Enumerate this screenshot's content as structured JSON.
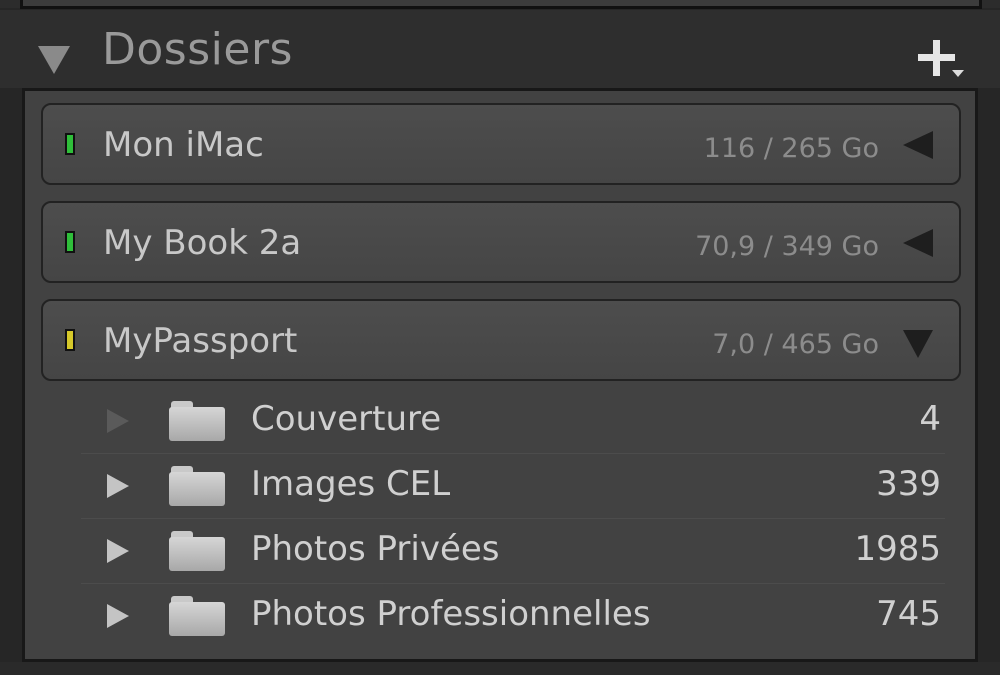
{
  "panel": {
    "title": "Dossiers",
    "add_icon": "plus-dropdown-icon",
    "collapse_icon": "triangle-down-icon"
  },
  "volumes": [
    {
      "name": "Mon iMac",
      "usage": "116 / 265 Go",
      "status_color": "#2fbf3a",
      "expanded": false
    },
    {
      "name": "My Book 2a",
      "usage": "70,9 / 349 Go",
      "status_color": "#2fbf3a",
      "expanded": false
    },
    {
      "name": "MyPassport",
      "usage": "7,0 / 465 Go",
      "status_color": "#d6c92a",
      "expanded": true
    }
  ],
  "folders": [
    {
      "name": "Couverture",
      "count": "4",
      "has_children": false
    },
    {
      "name": "Images CEL",
      "count": "339",
      "has_children": true
    },
    {
      "name": "Photos Privées",
      "count": "1985",
      "has_children": true
    },
    {
      "name": "Photos Professionnelles",
      "count": "745",
      "has_children": true
    }
  ],
  "colors": {
    "panel_bg": "#424242",
    "header_bg": "#2e2e2e",
    "text": "#d0d0d0",
    "title": "#9a9a9a"
  }
}
